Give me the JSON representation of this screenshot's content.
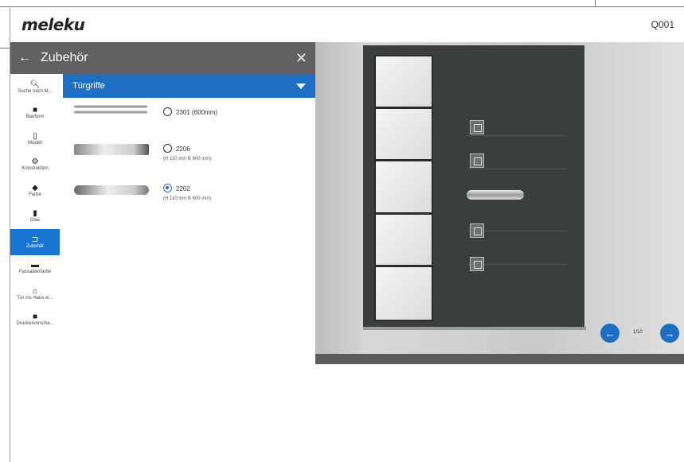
{
  "header": {
    "logo": "meleku",
    "code": "Q001"
  },
  "panel": {
    "back_icon": "arrow-left-icon",
    "title": "Zubehör",
    "close_icon": "close-icon"
  },
  "sidebar": {
    "items": [
      {
        "icon": "search-icon",
        "label": "Suche nach M..."
      },
      {
        "icon": "door-style-icon",
        "label": "Bauform"
      },
      {
        "icon": "door-model-icon",
        "label": "Modell"
      },
      {
        "icon": "gear-icon",
        "label": "Konstruktion"
      },
      {
        "icon": "paint-bucket-icon",
        "label": "Farbe"
      },
      {
        "icon": "glass-icon",
        "label": "Glas"
      },
      {
        "icon": "handle-icon",
        "label": "Zubehör"
      },
      {
        "icon": "panel-color-icon",
        "label": "Fassadenfarbe"
      },
      {
        "icon": "house-icon",
        "label": "Tür ins Haus ei..."
      },
      {
        "icon": "briefcase-icon",
        "label": "Druckervorscha..."
      }
    ],
    "active_index": 6
  },
  "dropdown": {
    "label": "Türgriffe"
  },
  "options": [
    {
      "label": "2301 (600mm)",
      "sub": "",
      "selected": false
    },
    {
      "label": "2206",
      "sub": "(H 110 mm B 600 mm)",
      "selected": false
    },
    {
      "label": "2202",
      "sub": "(H 110 mm B 600 mm)",
      "selected": true
    }
  ],
  "viewer": {
    "pager": "1/10"
  },
  "colors": {
    "accent": "#1e6fc4",
    "header_gray": "#616161",
    "door": "#3a3e3d"
  }
}
